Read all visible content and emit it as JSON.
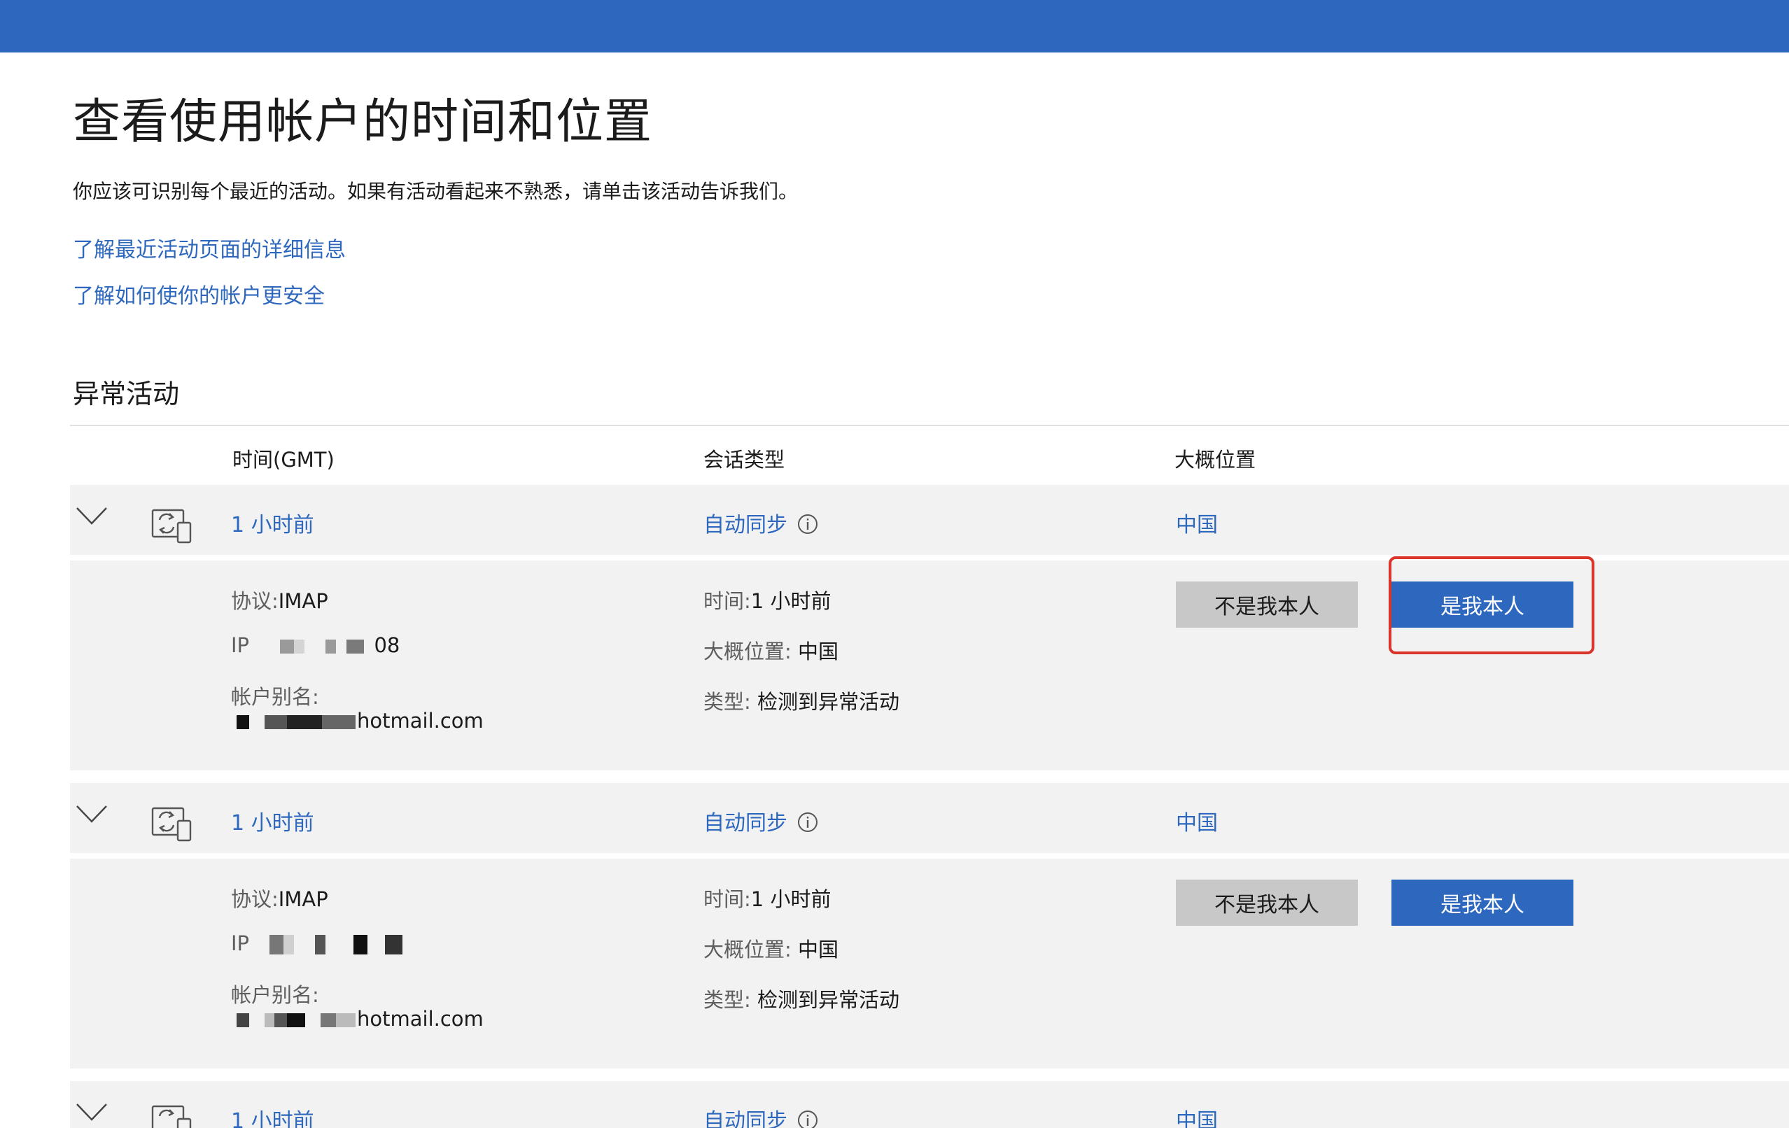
{
  "page": {
    "title": "查看使用帐户的时间和位置",
    "intro": "你应该可识别每个最近的活动。如果有活动看起来不熟悉，请单击该活动告诉我们。",
    "links": [
      "了解最近活动页面的详细信息",
      "了解如何使你的帐户更安全"
    ]
  },
  "section": {
    "title": "异常活动",
    "columns": [
      "时间(GMT)",
      "会话类型",
      "大概位置"
    ]
  },
  "activities": [
    {
      "time": "1 小时前",
      "session_type": "自动同步",
      "location": "中国",
      "protocol_label": "协议:",
      "protocol_value": "IMAP",
      "ip_label": "IP",
      "ip_tail": "08",
      "alias_label": "帐户别名:",
      "alias_value": "hotmail.com",
      "detail_time_label": "时间:",
      "detail_time_value": "1 小时前",
      "detail_loc_label": "大概位置:",
      "detail_loc_value": "中国",
      "detail_type_label": "类型:",
      "detail_type_value": "检测到异常活动",
      "not_me": "不是我本人",
      "is_me": "是我本人"
    },
    {
      "time": "1 小时前",
      "session_type": "自动同步",
      "location": "中国",
      "protocol_label": "协议:",
      "protocol_value": "IMAP",
      "ip_label": "IP",
      "ip_tail": "",
      "alias_label": "帐户别名:",
      "alias_value": "hotmail.com",
      "detail_time_label": "时间:",
      "detail_time_value": "1 小时前",
      "detail_loc_label": "大概位置:",
      "detail_loc_value": "中国",
      "detail_type_label": "类型:",
      "detail_type_value": "检测到异常活动",
      "not_me": "不是我本人",
      "is_me": "是我本人"
    },
    {
      "time": "1 小时前",
      "session_type": "自动同步",
      "location": "中国"
    }
  ],
  "colors": {
    "brand_blue": "#2d68be",
    "panel_gray": "#f2f2f2",
    "highlight_red": "#d9352b"
  }
}
